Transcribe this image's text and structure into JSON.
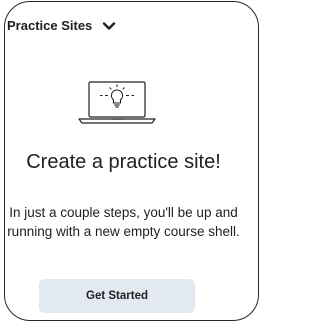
{
  "header": {
    "title": "Practice Sites",
    "dropdown_icon": "chevron-down-icon"
  },
  "illustration": {
    "icon": "laptop-lightbulb-icon"
  },
  "main": {
    "headline": "Create a practice site!",
    "description": "In just a couple steps, you'll be up and running with a new empty course shell.",
    "button_label": "Get Started"
  },
  "colors": {
    "text": "#202122",
    "border": "#23262b",
    "button_bg": "#e3e9f1"
  }
}
